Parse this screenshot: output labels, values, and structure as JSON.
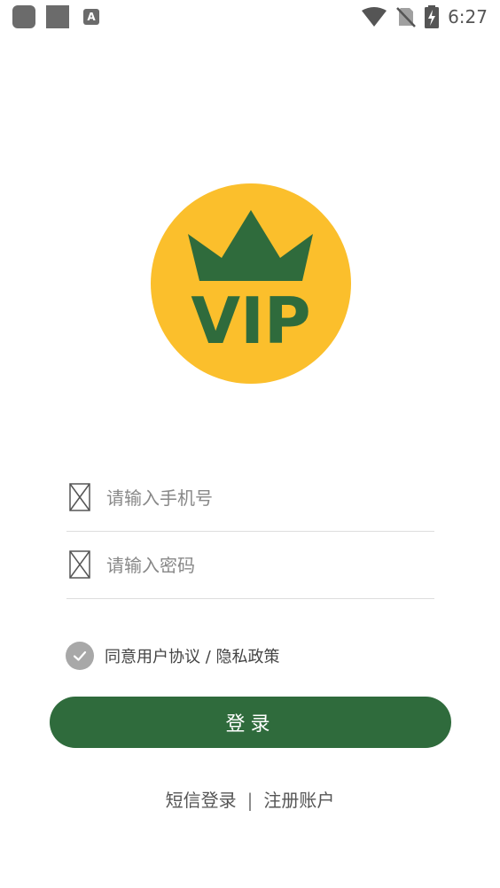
{
  "status_bar": {
    "time": "6:27",
    "notification_a": "A"
  },
  "logo": {
    "text": "VIP",
    "circle_color": "#fbbf2c",
    "crown_color": "#2f6b3c"
  },
  "phone_field": {
    "placeholder": "请输入手机号",
    "value": ""
  },
  "password_field": {
    "placeholder": "请输入密码",
    "value": ""
  },
  "agreement": {
    "checked": true,
    "text": "同意用户协议 / 隐私政策"
  },
  "login_button": {
    "label": "登录",
    "color": "#2f6b3c"
  },
  "links": {
    "sms_login": "短信登录",
    "separator": "|",
    "register": "注册账户"
  }
}
